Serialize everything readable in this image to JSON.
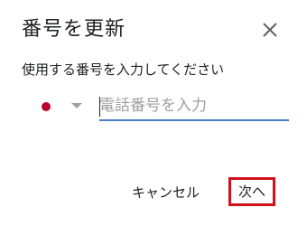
{
  "dialog": {
    "title": "番号を更新",
    "close_icon": "close-icon",
    "instruction": "使用する番号を入力してください",
    "country_flag_color": "#bc002d",
    "phone_input": {
      "placeholder": "電話番号を入力",
      "value": ""
    },
    "buttons": {
      "cancel": "キャンセル",
      "next": "次へ"
    },
    "colors": {
      "input_underline": "#4a7cc8",
      "highlight_border": "#d0101a"
    }
  }
}
